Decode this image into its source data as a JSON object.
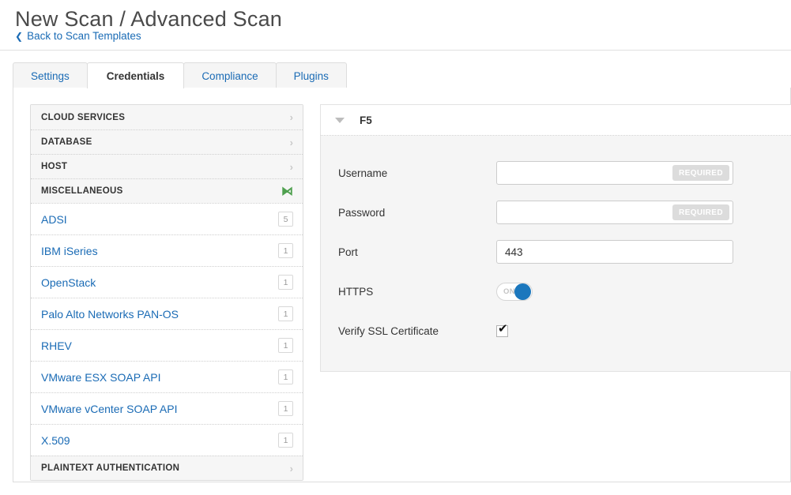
{
  "header": {
    "title": "New Scan / Advanced Scan",
    "back_link": "Back to Scan Templates",
    "back_chevron": "chevron-left-icon"
  },
  "tabs": [
    {
      "label": "Settings",
      "active": false
    },
    {
      "label": "Credentials",
      "active": true
    },
    {
      "label": "Compliance",
      "active": false
    },
    {
      "label": "Plugins",
      "active": false
    }
  ],
  "sidebar": {
    "categories": [
      {
        "label": "CLOUD SERVICES",
        "expanded": false,
        "arrow": "chevron-right-icon"
      },
      {
        "label": "DATABASE",
        "expanded": false,
        "arrow": "chevron-right-icon"
      },
      {
        "label": "HOST",
        "expanded": false,
        "arrow": "chevron-right-icon"
      },
      {
        "label": "MISCELLANEOUS",
        "expanded": true,
        "arrow": "chevron-down-icon"
      }
    ],
    "items": [
      {
        "label": "ADSI",
        "count": "5"
      },
      {
        "label": "IBM iSeries",
        "count": "1"
      },
      {
        "label": "OpenStack",
        "count": "1"
      },
      {
        "label": "Palo Alto Networks PAN-OS",
        "count": "1"
      },
      {
        "label": "RHEV",
        "count": "1"
      },
      {
        "label": "VMware ESX SOAP API",
        "count": "1"
      },
      {
        "label": "VMware vCenter SOAP API",
        "count": "1"
      },
      {
        "label": "X.509",
        "count": "1"
      }
    ],
    "footer_category": {
      "label": "PLAINTEXT AUTHENTICATION",
      "expanded": false,
      "arrow": "chevron-right-icon"
    }
  },
  "detail": {
    "title": "F5",
    "collapse_icon": "triangle-down-icon",
    "fields": {
      "username": {
        "label": "Username",
        "value": "",
        "placeholder": "",
        "badge": "REQUIRED"
      },
      "password": {
        "label": "Password",
        "value": "",
        "placeholder": "",
        "badge": "REQUIRED"
      },
      "port": {
        "label": "Port",
        "value": "443",
        "placeholder": ""
      },
      "https": {
        "label": "HTTPS",
        "state": "ON"
      },
      "verify_ssl": {
        "label": "Verify SSL Certificate",
        "checked": true,
        "tick": "✔"
      }
    }
  },
  "colors": {
    "link_blue": "#1a6bb5",
    "toggle_blue": "#1b77bd",
    "expanded_green": "#4fa04f",
    "required_gray": "#dcdcdc",
    "panel_bg": "#f5f5f5"
  }
}
